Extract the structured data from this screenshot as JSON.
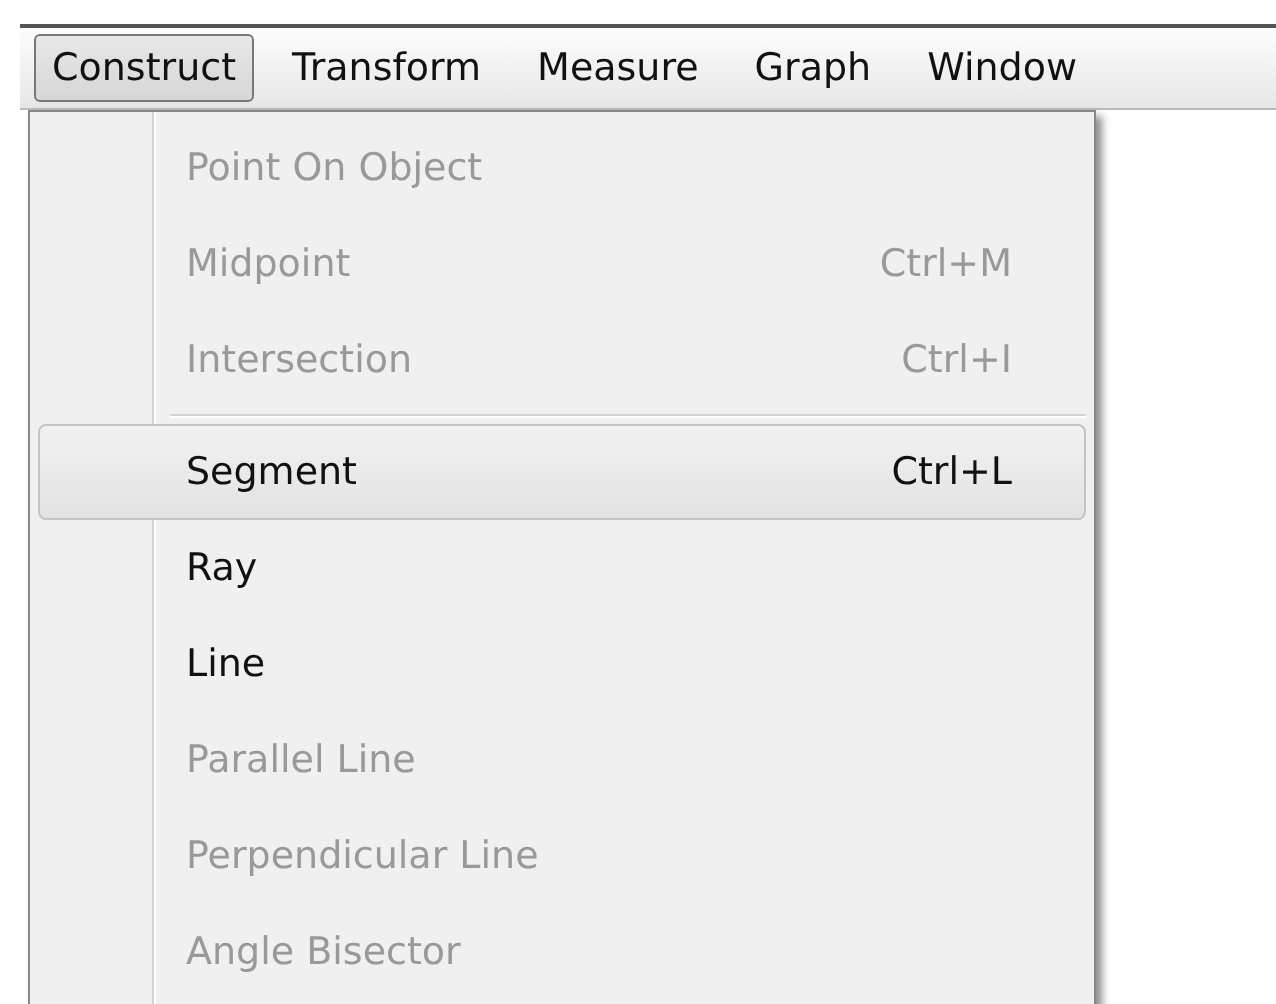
{
  "menu_bar": [
    {
      "label": "Construct",
      "selected": true
    },
    {
      "label": "Transform",
      "selected": false
    },
    {
      "label": "Measure",
      "selected": false
    },
    {
      "label": "Graph",
      "selected": false
    },
    {
      "label": "Window",
      "selected": false
    }
  ],
  "menu": [
    {
      "kind": "item",
      "label": "Point On Object",
      "disabled": true,
      "selected": false
    },
    {
      "kind": "item",
      "label": "Midpoint",
      "shortcut": "Ctrl+M",
      "disabled": true,
      "selected": false
    },
    {
      "kind": "item",
      "label": "Intersection",
      "shortcut": "Ctrl+I",
      "disabled": true,
      "selected": false
    },
    {
      "kind": "separator"
    },
    {
      "kind": "item",
      "label": "Segment",
      "shortcut": "Ctrl+L",
      "disabled": false,
      "selected": true
    },
    {
      "kind": "item",
      "label": "Ray",
      "disabled": false,
      "selected": false
    },
    {
      "kind": "item",
      "label": "Line",
      "disabled": false,
      "selected": false
    },
    {
      "kind": "item",
      "label": "Parallel Line",
      "disabled": true,
      "selected": false
    },
    {
      "kind": "item",
      "label": "Perpendicular Line",
      "disabled": true,
      "selected": false
    },
    {
      "kind": "item",
      "label": "Angle Bisector",
      "disabled": true,
      "selected": false
    }
  ]
}
